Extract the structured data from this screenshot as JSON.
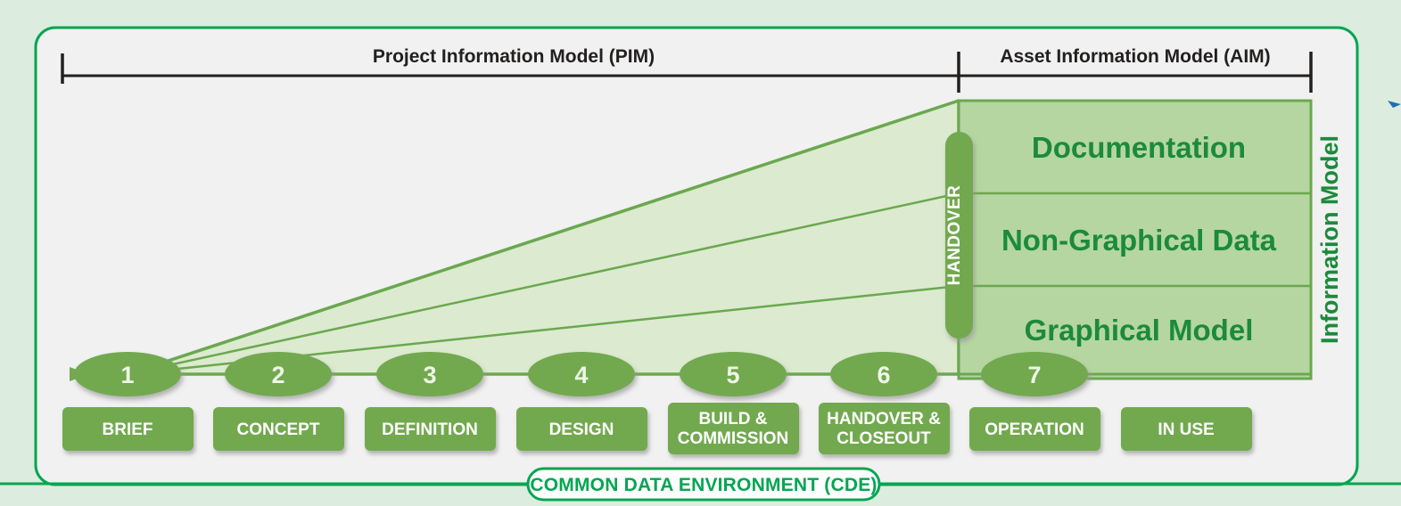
{
  "colors": {
    "page_bg": "#dcecdf",
    "panel_bg": "#f0f1f0",
    "panel_border": "#00a651",
    "wedge_fill": "#dceacf",
    "wedge_stroke": "#6aa84f",
    "aim_box_fill": "#b5d6a0",
    "aim_box_stroke": "#6aa84f",
    "stage_fill": "#72a94f",
    "stage_text": "#eef6e6",
    "label_fill": "#72a94f",
    "label_text": "#ffffff",
    "heading_text": "#221f1f",
    "green_text": "#1c8a3c",
    "cde_border": "#00a651",
    "cde_text": "#00a651",
    "accent_blue": "#1f6fb4"
  },
  "header": {
    "pim_title": "Project Information Model (PIM)",
    "aim_title": "Asset Information Model (AIM)"
  },
  "information_model": {
    "side_label": "Information Model",
    "layers": [
      {
        "label": "Documentation"
      },
      {
        "label": "Non-Graphical Data"
      },
      {
        "label": "Graphical Model"
      }
    ]
  },
  "handover": {
    "label": "HANDOVER"
  },
  "stages": [
    {
      "number": "1",
      "label": "BRIEF"
    },
    {
      "number": "2",
      "label": "CONCEPT"
    },
    {
      "number": "3",
      "label": "DEFINITION"
    },
    {
      "number": "4",
      "label": "DESIGN"
    },
    {
      "number": "5",
      "label": "BUILD &\nCOMMISSION"
    },
    {
      "number": "6",
      "label": "HANDOVER &\nCLOSEOUT"
    },
    {
      "number": "7",
      "label": "OPERATION"
    },
    {
      "number": "",
      "label": "IN USE"
    }
  ],
  "footer": {
    "cde_label": "COMMON DATA ENVIRONMENT (CDE)"
  }
}
